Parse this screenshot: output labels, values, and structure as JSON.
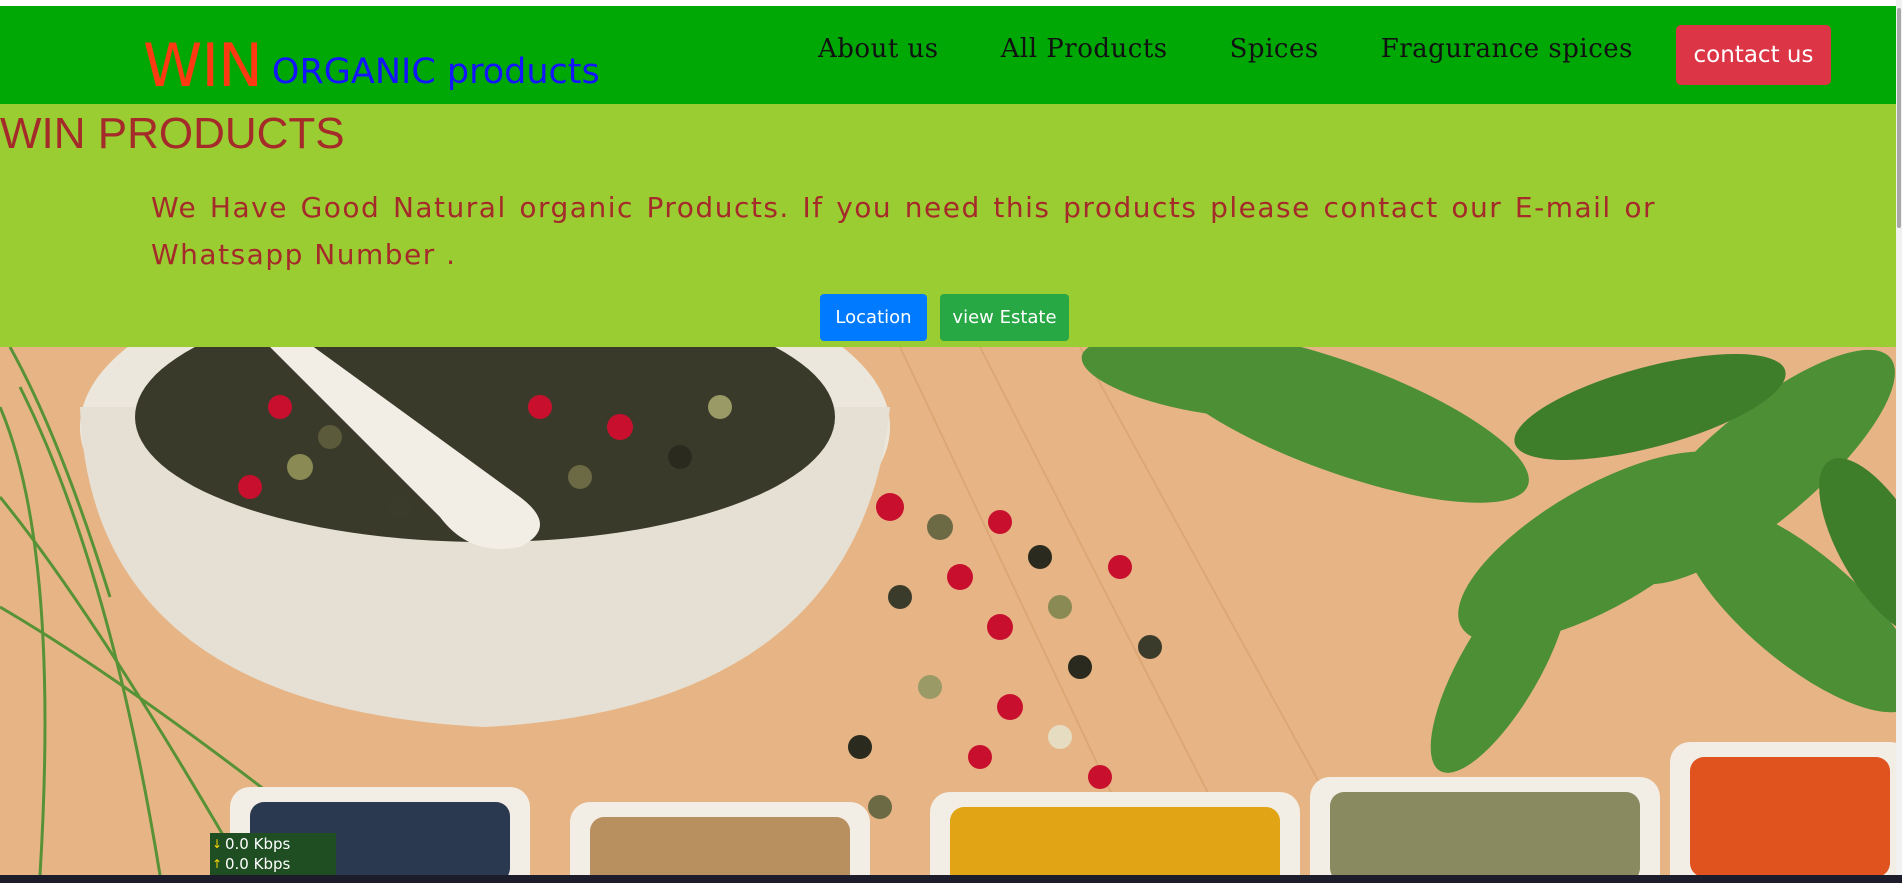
{
  "brand": {
    "win": "WIN",
    "rest": "ORGANIC products"
  },
  "nav": {
    "items": [
      {
        "label": "About us"
      },
      {
        "label": "All Products"
      },
      {
        "label": "Spices"
      },
      {
        "label": "Fragurance spices"
      }
    ],
    "contact_label": "contact us"
  },
  "hero": {
    "title": "WIN PRODUCTS",
    "text": "We Have Good Natural organic Products. If you need this products please contact our E-mail or Whatsapp Number .",
    "buttons": {
      "location": "Location",
      "estate": "view Estate"
    }
  },
  "speed_meter": {
    "download": "0.0 Kbps",
    "upload": "0.0 Kbps"
  },
  "colors": {
    "navbar": "#00a806",
    "brand_win": "#ff3a12",
    "brand_rest": "#1414ff",
    "hero_band": "#9acd32",
    "hero_text": "#a52a2a",
    "contact_button": "#dc3545",
    "location_button": "#007bff",
    "estate_button": "#28a745"
  }
}
